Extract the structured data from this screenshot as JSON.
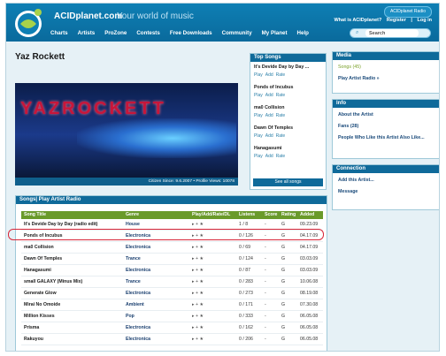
{
  "header": {
    "site_name": "ACIDplanet.com",
    "tagline": "Your world of music",
    "radio_button": "ACIDplanet Radio",
    "top_links": [
      "What is ACIDplanet?",
      "Register",
      "|",
      "Log in"
    ],
    "search_label": "Search",
    "nav": [
      "Charts",
      "Artists",
      "ProZone",
      "Contests",
      "Free Downloads",
      "Community",
      "My Planet",
      "Help"
    ]
  },
  "artist": {
    "name": "Yaz Rockett",
    "banner_text": "YAZROCKETT",
    "caption": "Citizen Since: 9.6.2007  •  Profile Views: 10078"
  },
  "top_songs": {
    "title": "Top Songs",
    "items": [
      {
        "title": "It's Devide Day by Day ..."
      },
      {
        "title": "Ponds of Incubus"
      },
      {
        "title": "ma0 Collision"
      },
      {
        "title": "Dawn Of Temples"
      },
      {
        "title": "Hanagasumi"
      }
    ],
    "actions": [
      "Play",
      "Add",
      "Rate"
    ],
    "see_all": "See all songs"
  },
  "media": {
    "title": "Media",
    "links": [
      "Songs (45)",
      "Play Artist Radio »"
    ]
  },
  "info": {
    "title": "Info",
    "links": [
      "About the Artist",
      "Fans (28)",
      "People Who Like this Artist Also Like..."
    ]
  },
  "connection": {
    "title": "Connection",
    "links": [
      "Add this Artist...",
      "Message"
    ]
  },
  "songs_panel": {
    "title": "Songs| Play Artist Radio",
    "columns": {
      "title": "Song Title",
      "genre": "Genre",
      "actions": "Play/Add/Rate/DL",
      "listens": "Listens",
      "score": "Score",
      "rating": "Rating",
      "added": "Added"
    },
    "action_icons": "▸  +  ★",
    "rows": [
      {
        "title": "It's Devide Day by Day (radio edit)",
        "genre": "House",
        "listens": "1 / 8",
        "score": "-",
        "rating": "G",
        "added": "09.23.09"
      },
      {
        "title": "Ponds of Incubus",
        "genre": "Electronica",
        "listens": "0 / 126",
        "score": "-",
        "rating": "G",
        "added": "04.17.09"
      },
      {
        "title": "ma0 Collision",
        "genre": "Electronica",
        "listens": "0 / 69",
        "score": "-",
        "rating": "G",
        "added": "04.17.09"
      },
      {
        "title": "Dawn Of Temples",
        "genre": "Trance",
        "listens": "0 / 124",
        "score": "-",
        "rating": "G",
        "added": "03.03.09"
      },
      {
        "title": "Hanagasumi",
        "genre": "Electronica",
        "listens": "0 / 87",
        "score": "-",
        "rating": "G",
        "added": "03.03.09"
      },
      {
        "title": "small GALAXY (Minus Mix)",
        "genre": "Trance",
        "listens": "0 / 283",
        "score": "-",
        "rating": "G",
        "added": "10.06.08"
      },
      {
        "title": "Generate Glow",
        "genre": "Electronica",
        "listens": "0 / 273",
        "score": "-",
        "rating": "G",
        "added": "08.19.08"
      },
      {
        "title": "Mirai No Omoide",
        "genre": "Ambient",
        "listens": "0 / 171",
        "score": "-",
        "rating": "G",
        "added": "07.30.08"
      },
      {
        "title": "Million Kisses",
        "genre": "Pop",
        "listens": "0 / 333",
        "score": "-",
        "rating": "G",
        "added": "06.05.08"
      },
      {
        "title": "Prisma",
        "genre": "Electronica",
        "listens": "0 / 162",
        "score": "-",
        "rating": "G",
        "added": "06.05.08"
      },
      {
        "title": "Rakuyou",
        "genre": "Electronica",
        "listens": "0 / 206",
        "score": "-",
        "rating": "G",
        "added": "06.05.08"
      }
    ]
  },
  "colors": {
    "brand_blue": "#0e7fb4",
    "accent_green": "#6a9a2a",
    "highlight_red": "#d8283a"
  }
}
